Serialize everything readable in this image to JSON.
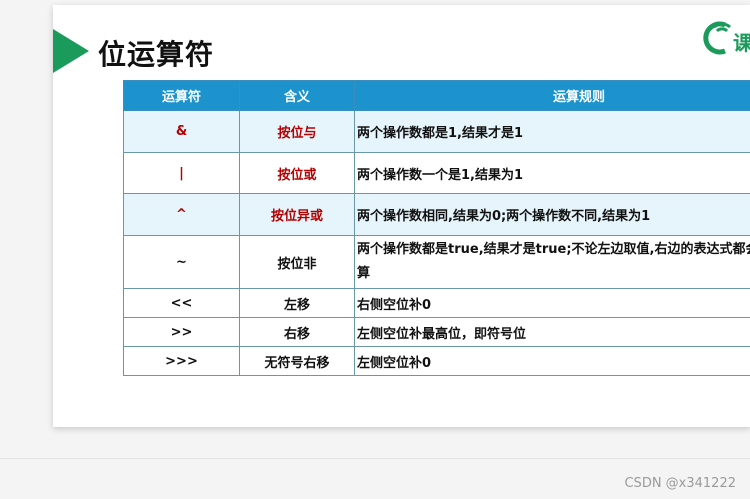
{
  "slide": {
    "title": "位运算符",
    "logo_text": "课",
    "colors": {
      "arrow": "#1a9b5b",
      "header": "#1c93cc",
      "shade": "#e6f5fb",
      "red_text": "#b30000"
    }
  },
  "table": {
    "headers": [
      "运算符",
      "含义",
      "运算规则"
    ],
    "rows": [
      {
        "op": "&",
        "meaning": "按位与",
        "rule": "两个操作数都是1,结果才是1"
      },
      {
        "op": "|",
        "meaning": "按位或",
        "rule": "两个操作数一个是1,结果为1"
      },
      {
        "op": "^",
        "meaning": "按位异或",
        "rule": "两个操作数相同,结果为0;两个操作数不同,结果为1"
      },
      {
        "op": "~",
        "meaning": "按位非",
        "rule": "两个操作数都是true,结果才是true;不论左边取值,右边的表达式都会进行运算"
      },
      {
        "op": "<<",
        "meaning": "左移",
        "rule": "右侧空位补0"
      },
      {
        "op": ">>",
        "meaning": "右移",
        "rule": "左侧空位补最高位，即符号位"
      },
      {
        "op": ">>>",
        "meaning": "无符号右移",
        "rule": "左侧空位补0"
      }
    ]
  },
  "watermark": "CSDN @x341222"
}
